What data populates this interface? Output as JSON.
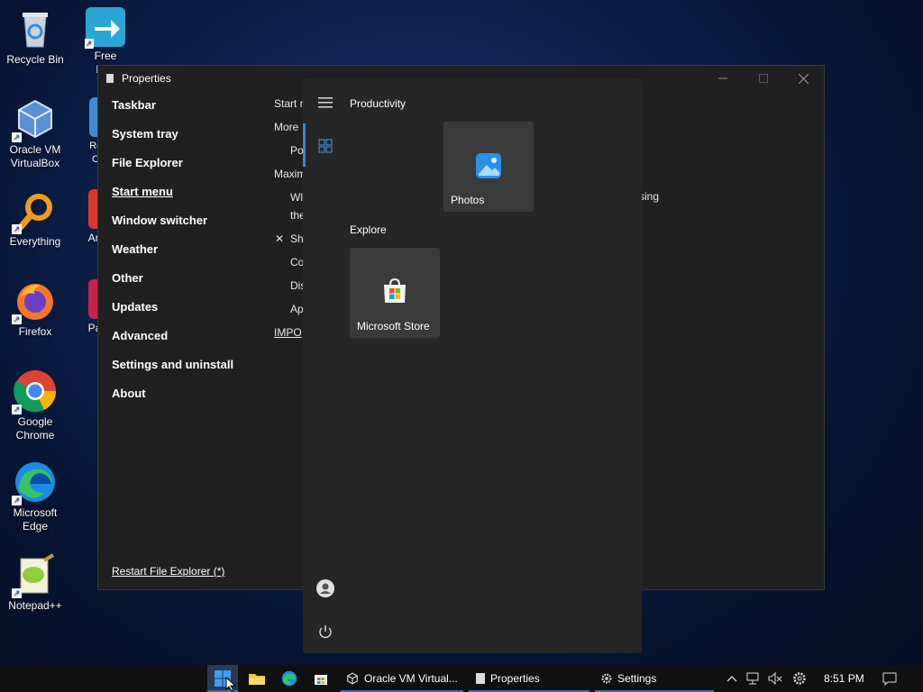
{
  "desktop": {
    "icons": [
      {
        "label": "Recycle Bin"
      },
      {
        "label": "Oracle VM VirtualBox"
      },
      {
        "label": "Everything"
      },
      {
        "label": "Firefox"
      },
      {
        "label": "Google Chrome"
      },
      {
        "label": "Microsoft Edge"
      },
      {
        "label": "Notepad++"
      }
    ],
    "partial_icons": [
      {
        "label": "Free Dov"
      },
      {
        "label": "Rec Co"
      },
      {
        "label": "An"
      },
      {
        "label": "Pa"
      }
    ]
  },
  "properties": {
    "title": "Properties",
    "nav": [
      "Taskbar",
      "System tray",
      "File Explorer",
      "Start menu",
      "Window switcher",
      "Weather",
      "Other",
      "Updates",
      "Advanced",
      "Settings and uninstall",
      "About"
    ],
    "active_nav": "Start menu",
    "restart_link": "Restart File Explorer (*)",
    "content_fragments": [
      "Start r",
      "More",
      "Po",
      "Maxim",
      "Wl",
      "the",
      "Sh",
      "Co",
      "Dis",
      "Ap",
      "IMPO",
      "sing"
    ],
    "checkbox_mark": "✕"
  },
  "start_menu": {
    "productivity_title": "Productivity",
    "explore_title": "Explore",
    "tiles": {
      "photos": "Photos",
      "store": "Microsoft Store"
    }
  },
  "taskbar": {
    "tasks": [
      "Oracle VM Virtual...",
      "Properties",
      "Settings"
    ],
    "clock": "8:51 PM"
  },
  "colors": {
    "accent": "#3c82dc",
    "window_bg": "#202020",
    "start_bg": "#262626",
    "tile_bg": "#3a3a3a"
  }
}
